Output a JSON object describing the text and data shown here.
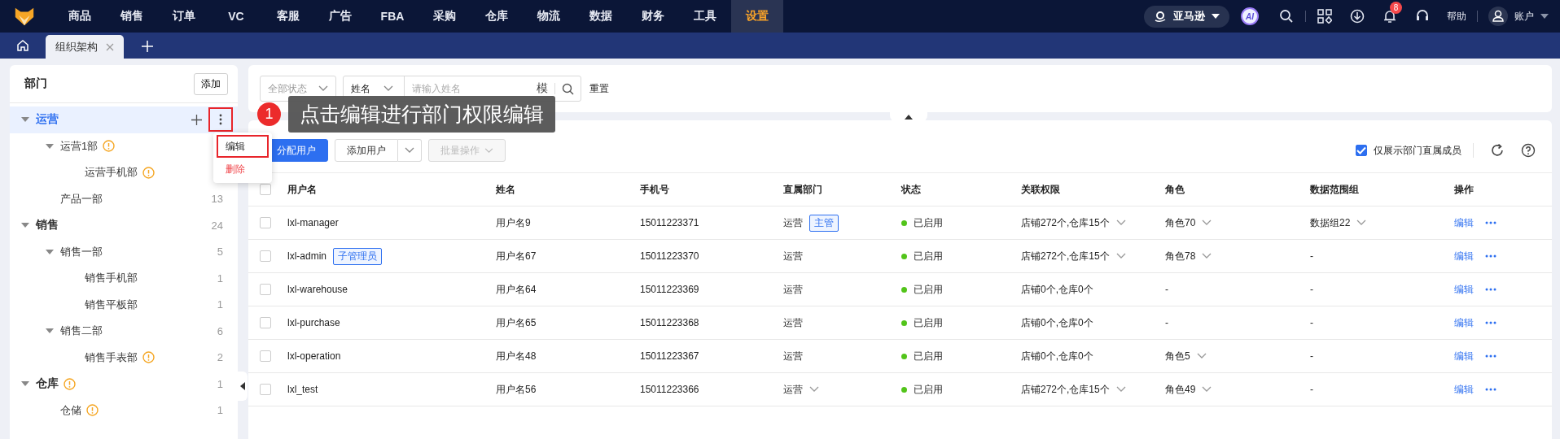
{
  "nav": {
    "items": [
      {
        "label": "商品",
        "selected": false
      },
      {
        "label": "销售",
        "selected": false
      },
      {
        "label": "订单",
        "selected": false
      },
      {
        "label": "VC",
        "selected": false
      },
      {
        "label": "客服",
        "selected": false
      },
      {
        "label": "广告",
        "selected": false
      },
      {
        "label": "FBA",
        "selected": false
      },
      {
        "label": "采购",
        "selected": false
      },
      {
        "label": "仓库",
        "selected": false
      },
      {
        "label": "物流",
        "selected": false
      },
      {
        "label": "数据",
        "selected": false
      },
      {
        "label": "财务",
        "selected": false
      },
      {
        "label": "工具",
        "selected": false
      },
      {
        "label": "设置",
        "selected": true
      }
    ],
    "store": "亚马逊",
    "ai": "AI",
    "notifications": "8",
    "help": "帮助",
    "account": "账户"
  },
  "tabs": [
    {
      "label": "组织架构",
      "selected": true
    }
  ],
  "departments": {
    "title": "部门",
    "add_button": "添加",
    "more_highlighted": true,
    "tree": [
      {
        "name": "运营",
        "selected": true,
        "expanded": true,
        "warning": false,
        "children": [
          {
            "name": "运营1部",
            "selected": false,
            "expanded": true,
            "warning": true,
            "children": [
              {
                "name": "运营手机部",
                "selected": false,
                "warning": true
              }
            ]
          },
          {
            "name": "产品一部",
            "selected": false,
            "warning": false,
            "count": "13"
          }
        ]
      },
      {
        "name": "销售",
        "selected": false,
        "expanded": true,
        "warning": false,
        "count": "24",
        "children": [
          {
            "name": "销售一部",
            "selected": false,
            "expanded": true,
            "warning": false,
            "count": "5",
            "children": [
              {
                "name": "销售手机部",
                "selected": false,
                "warning": false,
                "count": "1"
              },
              {
                "name": "销售平板部",
                "selected": false,
                "warning": false,
                "count": "1"
              }
            ]
          },
          {
            "name": "销售二部",
            "selected": false,
            "expanded": true,
            "warning": false,
            "count": "6",
            "children": [
              {
                "name": "销售手表部",
                "selected": false,
                "warning": true,
                "count": "2"
              }
            ]
          }
        ]
      },
      {
        "name": "仓库",
        "selected": false,
        "expanded": true,
        "warning": true,
        "count": "1",
        "children": [
          {
            "name": "仓储",
            "selected": false,
            "warning": true,
            "count": "1"
          }
        ]
      }
    ]
  },
  "dept_menu": [
    {
      "label": "编辑",
      "kind": "normal",
      "highlighted": true
    },
    {
      "label": "删除",
      "kind": "danger",
      "highlighted": false
    }
  ],
  "tooltip": {
    "step": "1",
    "text": "点击编辑进行部门权限编辑"
  },
  "filters": {
    "status": "全部状态",
    "field": "姓名",
    "placeholder": "请输入姓名",
    "fuzzy": "模",
    "reset": "重置"
  },
  "toolbar": {
    "buttons": [
      {
        "label": "分配用户",
        "kind": "primary"
      },
      {
        "label": "添加用户",
        "kind": "split"
      },
      {
        "label": "批量操作",
        "kind": "dropdown",
        "disabled": true
      }
    ],
    "direct_only": {
      "label": "仅展示部门直属成员",
      "checked": true
    }
  },
  "table": {
    "select_all_checked": false,
    "columns": [
      "用户名",
      "姓名",
      "手机号",
      "直属部门",
      "状态",
      "关联权限",
      "角色",
      "数据范围组",
      "操作"
    ],
    "rows": [
      {
        "checked": false,
        "username": "lxl-manager",
        "name": "用户名9",
        "phone": "15011223371",
        "dept": "运营",
        "dept_tag": "主管",
        "dept_dropdown": false,
        "status": "已启用",
        "permission": "店铺272个,仓库15个",
        "permission_dropdown": true,
        "role": "角色70",
        "role_dropdown": true,
        "data_group": "数据组22",
        "data_group_dropdown": true,
        "action": "编辑"
      },
      {
        "checked": false,
        "username": "lxl-admin",
        "user_tag": "子管理员",
        "name": "用户名67",
        "phone": "15011223370",
        "dept": "运营",
        "dept_dropdown": false,
        "status": "已启用",
        "permission": "店铺272个,仓库15个",
        "permission_dropdown": true,
        "role": "角色78",
        "role_dropdown": true,
        "data_group": "-",
        "data_group_dropdown": false,
        "action": "编辑"
      },
      {
        "checked": false,
        "username": "lxl-warehouse",
        "name": "用户名64",
        "phone": "15011223369",
        "dept": "运营",
        "dept_dropdown": false,
        "status": "已启用",
        "permission": "店铺0个,仓库0个",
        "permission_dropdown": false,
        "role": "-",
        "role_dropdown": false,
        "data_group": "-",
        "data_group_dropdown": false,
        "action": "编辑"
      },
      {
        "checked": false,
        "username": "lxl-purchase",
        "name": "用户名65",
        "phone": "15011223368",
        "dept": "运营",
        "dept_dropdown": false,
        "status": "已启用",
        "permission": "店铺0个,仓库0个",
        "permission_dropdown": false,
        "role": "-",
        "role_dropdown": false,
        "data_group": "-",
        "data_group_dropdown": false,
        "action": "编辑"
      },
      {
        "checked": false,
        "username": "lxl-operation",
        "name": "用户名48",
        "phone": "15011223367",
        "dept": "运营",
        "dept_dropdown": false,
        "status": "已启用",
        "permission": "店铺0个,仓库0个",
        "permission_dropdown": false,
        "role": "角色5",
        "role_dropdown": true,
        "data_group": "-",
        "data_group_dropdown": false,
        "action": "编辑"
      },
      {
        "checked": false,
        "username": "lxl_test",
        "name": "用户名56",
        "phone": "15011223366",
        "dept": "运营",
        "dept_dropdown": true,
        "status": "已启用",
        "permission": "店铺272个,仓库15个",
        "permission_dropdown": true,
        "role": "角色49",
        "role_dropdown": true,
        "data_group": "-",
        "data_group_dropdown": false,
        "action": "编辑"
      }
    ]
  }
}
